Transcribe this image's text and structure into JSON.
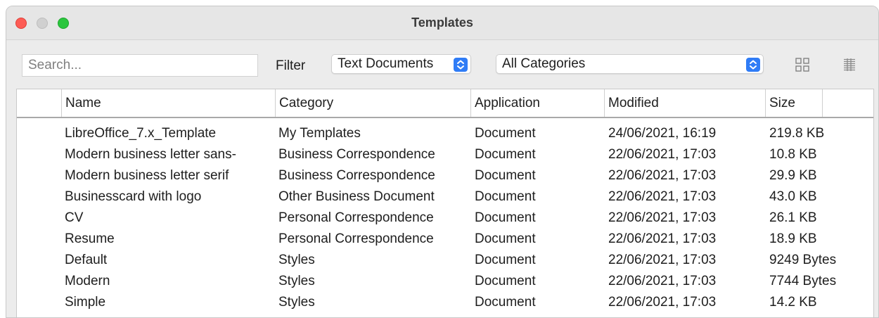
{
  "window": {
    "title": "Templates"
  },
  "toolbar": {
    "search_placeholder": "Search...",
    "filter_label": "Filter",
    "filter_value": "Text Documents",
    "category_value": "All Categories"
  },
  "table": {
    "columns": [
      "Name",
      "Category",
      "Application",
      "Modified",
      "Size"
    ],
    "rows": [
      {
        "name": "LibreOffice_7.x_Template",
        "category": "My Templates",
        "application": "Document",
        "modified": "24/06/2021, 16:19",
        "size": "219.8 KB"
      },
      {
        "name": "Modern business letter sans-",
        "category": "Business Correspondence",
        "application": "Document",
        "modified": "22/06/2021, 17:03",
        "size": "10.8 KB"
      },
      {
        "name": "Modern business letter serif",
        "category": "Business Correspondence",
        "application": "Document",
        "modified": "22/06/2021, 17:03",
        "size": "29.9 KB"
      },
      {
        "name": "Businesscard with logo",
        "category": "Other Business Document",
        "application": "Document",
        "modified": "22/06/2021, 17:03",
        "size": "43.0 KB"
      },
      {
        "name": "CV",
        "category": "Personal Correspondence",
        "application": "Document",
        "modified": "22/06/2021, 17:03",
        "size": "26.1 KB"
      },
      {
        "name": "Resume",
        "category": "Personal Correspondence",
        "application": "Document",
        "modified": "22/06/2021, 17:03",
        "size": "18.9 KB"
      },
      {
        "name": "Default",
        "category": "Styles",
        "application": "Document",
        "modified": "22/06/2021, 17:03",
        "size": "9249 Bytes"
      },
      {
        "name": "Modern",
        "category": "Styles",
        "application": "Document",
        "modified": "22/06/2021, 17:03",
        "size": "7744 Bytes"
      },
      {
        "name": "Simple",
        "category": "Styles",
        "application": "Document",
        "modified": "22/06/2021, 17:03",
        "size": "14.2 KB"
      }
    ]
  },
  "colors": {
    "close": "#fd5c55",
    "minimize": "#d0d0d0",
    "maximize": "#2bc63e",
    "accent": "#2f7cf6"
  },
  "icons": [
    "close-icon",
    "minimize-icon",
    "maximize-icon",
    "stepper-icon",
    "thumbnail-view-icon",
    "list-view-icon"
  ]
}
